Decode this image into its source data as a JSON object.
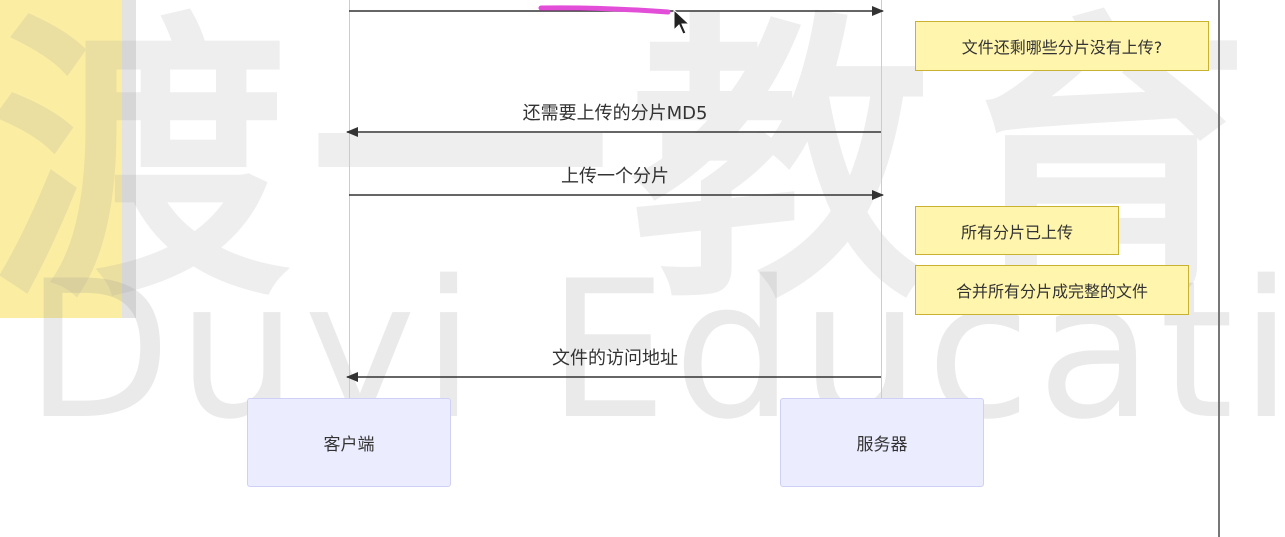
{
  "actors": {
    "client": "客户端",
    "server": "服务器"
  },
  "messages": [
    {
      "label": "",
      "direction": "to-server"
    },
    {
      "label": "还需要上传的分片MD5",
      "direction": "to-client"
    },
    {
      "label": "上传一个分片",
      "direction": "to-server"
    },
    {
      "label": "文件的访问地址",
      "direction": "to-client"
    }
  ],
  "notes": [
    "文件还剩哪些分片没有上传?",
    "所有分片已上传",
    "合并所有分片成完整的文件"
  ],
  "watermark": {
    "cn": "渡一教育",
    "en": "Duyi Education"
  },
  "colors": {
    "actor_fill": "#ececff",
    "note_fill": "#fff5ad",
    "highlight_stroke": "#e24ed8"
  }
}
